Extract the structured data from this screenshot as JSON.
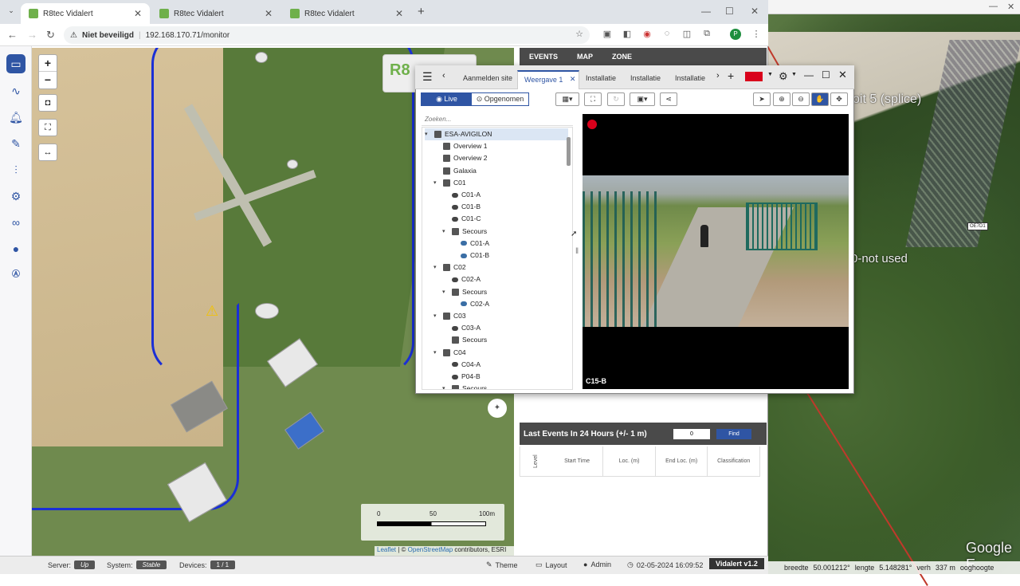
{
  "browser": {
    "tabs": [
      {
        "title": "R8tec Vidalert"
      },
      {
        "title": "R8tec Vidalert"
      },
      {
        "title": "R8tec Vidalert"
      }
    ],
    "security_label": "Niet beveiligd",
    "url": "192.168.170.71/monitor",
    "profile_initial": "P"
  },
  "background_app": {
    "label1": "oit 5 (splice)",
    "label2": "0-not used",
    "tag": "OE7D1",
    "google": "Google E",
    "status": [
      "breedte",
      "50.001212°",
      "lengte",
      "5.148281°",
      "verh",
      "337 m",
      "ooghoogte"
    ]
  },
  "map": {
    "scale_labels": [
      "0",
      "50",
      "100m"
    ],
    "attribution": {
      "leaflet": "Leaflet",
      "sep": " | © ",
      "osm": "OpenStreetMap",
      "rest": " contributors, ESRI"
    }
  },
  "panel": {
    "tabs": [
      "EVENTS",
      "MAP",
      "ZONE"
    ],
    "last_events_title": "Last Events In 24 Hours (+/- 1 m)",
    "minutes_value": "0",
    "find_label": "Find",
    "columns": [
      "Level",
      "Start Time",
      "Loc. (m)",
      "End Loc. (m)",
      "Classification"
    ]
  },
  "statusbar": {
    "server_label": "Server:",
    "server_value": "Up",
    "system_label": "System:",
    "system_value": "Stable",
    "devices_label": "Devices:",
    "devices_value": "1 / 1",
    "theme": "Theme",
    "layout": "Layout",
    "user": "Admin",
    "datetime": "02-05-2024 16:09:52",
    "version": "Vidalert v1.2"
  },
  "avigilon": {
    "tabs": [
      "Aanmelden site",
      "Weergave 1",
      "Installatie",
      "Installatie",
      "Installatie"
    ],
    "live_label": "Live",
    "recorded_label": "Opgenomen",
    "search_placeholder": "Zoeken...",
    "tree": [
      {
        "label": "ESA-AVIGILON",
        "level": 0,
        "type": "site",
        "expanded": true
      },
      {
        "label": "Overview 1",
        "level": 1,
        "type": "view"
      },
      {
        "label": "Overview 2",
        "level": 1,
        "type": "view"
      },
      {
        "label": "Galaxia",
        "level": 1,
        "type": "view"
      },
      {
        "label": "C01",
        "level": 1,
        "type": "folder",
        "expanded": true
      },
      {
        "label": "C01-A",
        "level": 2,
        "type": "camera"
      },
      {
        "label": "C01-B",
        "level": 2,
        "type": "camera"
      },
      {
        "label": "C01-C",
        "level": 2,
        "type": "camera"
      },
      {
        "label": "Secours",
        "level": 2,
        "type": "folder",
        "expanded": true
      },
      {
        "label": "C01-A",
        "level": 3,
        "type": "camera-blue"
      },
      {
        "label": "C01-B",
        "level": 3,
        "type": "camera-blue"
      },
      {
        "label": "C02",
        "level": 1,
        "type": "folder",
        "expanded": true
      },
      {
        "label": "C02-A",
        "level": 2,
        "type": "camera"
      },
      {
        "label": "Secours",
        "level": 2,
        "type": "folder",
        "expanded": true
      },
      {
        "label": "C02-A",
        "level": 3,
        "type": "camera-blue"
      },
      {
        "label": "C03",
        "level": 1,
        "type": "folder",
        "expanded": true
      },
      {
        "label": "C03-A",
        "level": 2,
        "type": "camera"
      },
      {
        "label": "Secours",
        "level": 2,
        "type": "folder"
      },
      {
        "label": "C04",
        "level": 1,
        "type": "folder",
        "expanded": true
      },
      {
        "label": "C04-A",
        "level": 2,
        "type": "camera"
      },
      {
        "label": "P04-B",
        "level": 2,
        "type": "camera"
      },
      {
        "label": "Secours",
        "level": 2,
        "type": "folder",
        "expanded": true
      }
    ],
    "video_label": "C15-B"
  },
  "colors": {
    "accent": "#2f55a4",
    "record": "#d9001b",
    "path": "#1a2fd6"
  }
}
